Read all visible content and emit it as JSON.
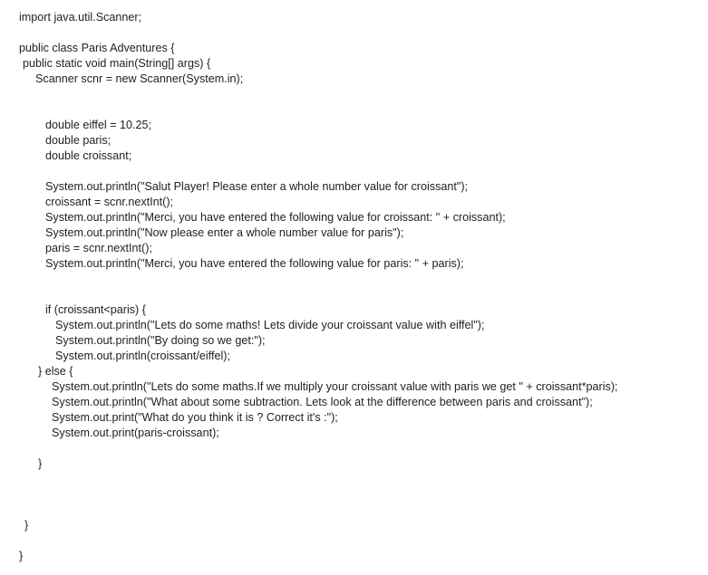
{
  "document": {
    "lines": [
      "import java.util.Scanner;",
      "public class Paris Adventures {",
      "public static void main(String[] args) {",
      "Scanner scnr = new Scanner(System.in);",
      "double eiffel = 10.25;",
      "double paris;",
      "double croissant;",
      "System.out.println(\"Salut Player! Please enter a whole number value for croissant\");",
      "croissant = scnr.nextInt();",
      "System.out.println(\"Merci, you have entered the following value for croissant: \" + croissant);",
      "System.out.println(\"Now please enter a whole number value for paris\");",
      "paris = scnr.nextInt();",
      "System.out.println(\"Merci, you have entered the following value for paris: \" + paris);",
      "if (croissant<paris) {",
      "System.out.println(\"Lets do some maths! Lets divide your croissant value with eiffel\");",
      "System.out.println(\"By doing so we get:\");",
      "System.out.println(croissant/eiffel);",
      "} else {",
      "System.out.println(\"Lets do some maths.If we multiply your croissant value with paris we get \" + croissant*paris);",
      "System.out.println(\"What about some subtraction. Lets look at the difference between paris and croissant\");",
      "System.out.print(\"What do you think it is ? Correct it's :\");",
      "System.out.print(paris-croissant);",
      "}",
      "}",
      "}"
    ]
  }
}
